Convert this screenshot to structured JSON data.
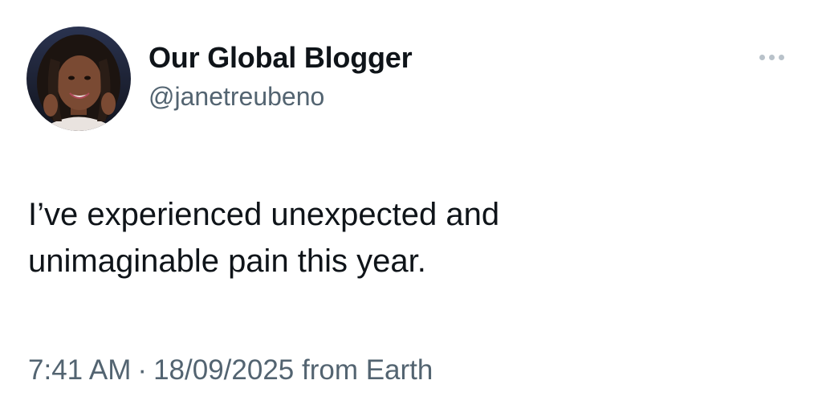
{
  "author": {
    "display_name": "Our Global Blogger",
    "handle": "@janetreubeno",
    "avatar_icon": "profile-photo"
  },
  "more_icon": "ellipsis-icon",
  "tweet": {
    "text_lines": [
      "I’ve experienced unexpected and",
      "unimaginable pain this year."
    ]
  },
  "meta": {
    "time": "7:41 AM",
    "separator": "·",
    "date": "18/09/2025",
    "source": "from Earth"
  },
  "colors": {
    "text": "#0f1419",
    "secondary": "#536471",
    "more_dots": "#b9c2ca",
    "background": "#ffffff"
  }
}
